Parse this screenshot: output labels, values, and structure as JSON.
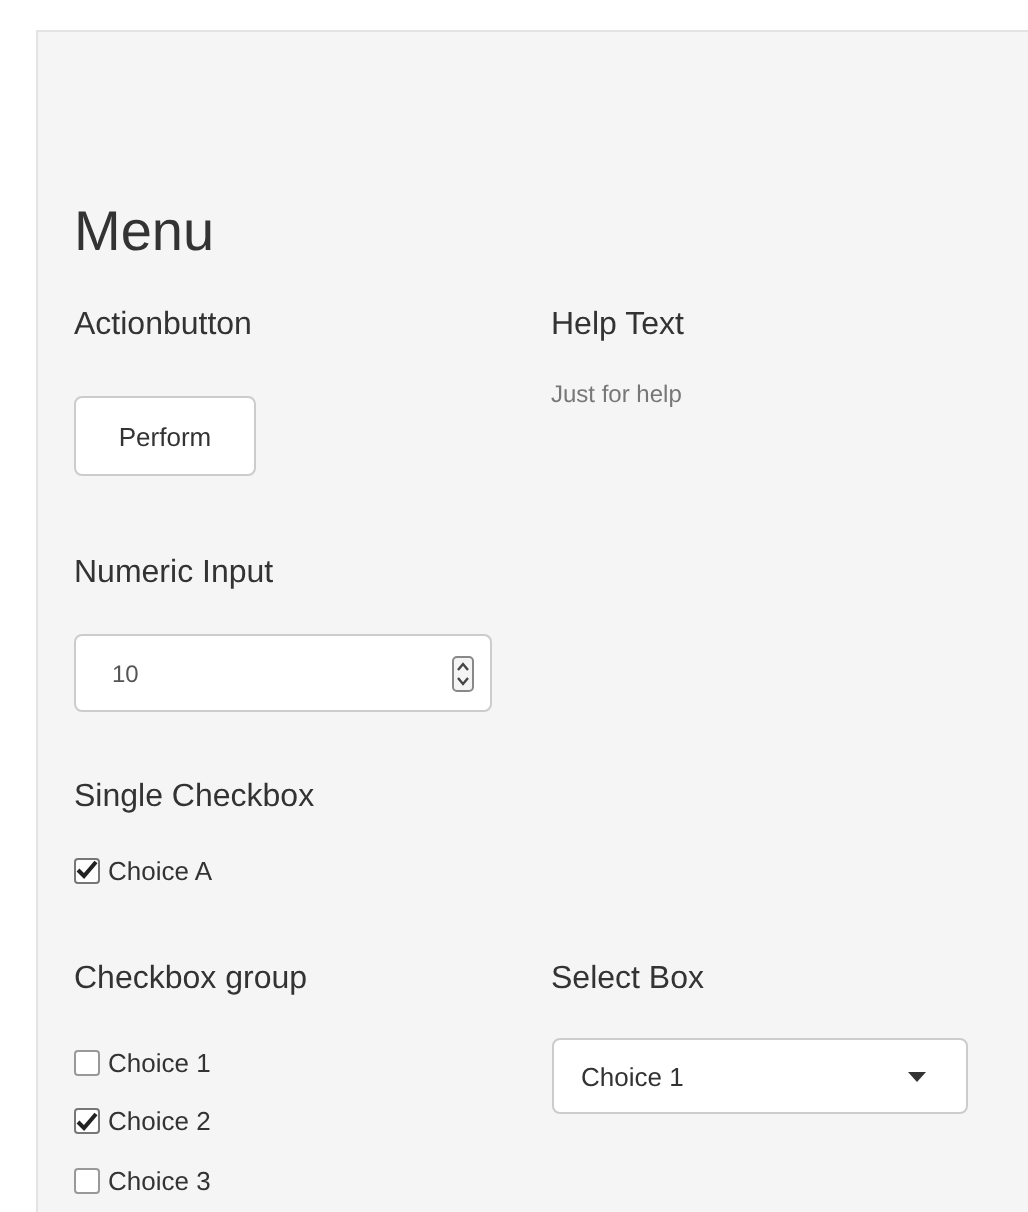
{
  "title": "Menu",
  "action": {
    "label": "Actionbutton",
    "button": "Perform"
  },
  "help": {
    "label": "Help Text",
    "text": "Just for help"
  },
  "numeric": {
    "label": "Numeric Input",
    "value": "10"
  },
  "single_checkbox": {
    "label": "Single Checkbox",
    "option": {
      "label": "Choice A",
      "checked": true
    }
  },
  "checkbox_group": {
    "label": "Checkbox group",
    "options": [
      {
        "label": "Choice 1",
        "checked": false
      },
      {
        "label": "Choice 2",
        "checked": true
      },
      {
        "label": "Choice 3",
        "checked": false
      }
    ]
  },
  "select": {
    "label": "Select Box",
    "value": "Choice 1"
  }
}
